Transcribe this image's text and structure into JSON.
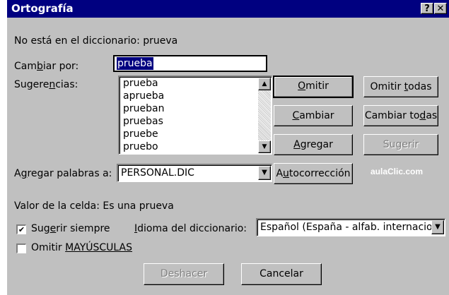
{
  "window": {
    "title": "Ortografía",
    "help_button": "?",
    "close_button": "✕"
  },
  "not_in_dictionary": "No está en el diccionario: prueva",
  "change_to": {
    "label_pre": "Cam",
    "label_u": "b",
    "label_post": "iar por:",
    "value": "prueba"
  },
  "suggestions": {
    "label_pre": "Sugere",
    "label_u": "n",
    "label_post": "cias:",
    "items": [
      "prueba",
      "aprueba",
      "prueban",
      "pruebas",
      "pruebe",
      "pruebo"
    ]
  },
  "buttons": {
    "omitir": {
      "pre": "",
      "u": "O",
      "post": "mitir"
    },
    "omitir_todas": {
      "pre": "Omitir ",
      "u": "t",
      "post": "odas"
    },
    "cambiar": {
      "pre": "",
      "u": "C",
      "post": "ambiar"
    },
    "cambiar_todas": {
      "pre": "Cambiar to",
      "u": "d",
      "post": "as"
    },
    "agregar": {
      "pre": "",
      "u": "A",
      "post": "gregar"
    },
    "sugerir": {
      "pre": "",
      "u": "",
      "post": "Sugerir"
    },
    "autocorreccion": {
      "pre": "A",
      "u": "u",
      "post": "tocorrección"
    },
    "deshacer": "Deshacer",
    "cancelar": "Cancelar"
  },
  "add_words": {
    "label_pre": "A",
    "label_u": "g",
    "label_post": "regar palabras a:",
    "value": "PERSONAL.DIC"
  },
  "watermark": "aulaClic.com",
  "cell_value": "Valor de la celda: Es una prueva",
  "suggest_always": {
    "pre": "Sug",
    "u": "e",
    "post": "rir siempre",
    "checked": true
  },
  "ignore_uppercase": {
    "pre": "Omitir ",
    "u": "MAYÚSCULAS",
    "post": "",
    "checked": false
  },
  "dictionary_language": {
    "label_pre": "",
    "label_u": "I",
    "label_post": "dioma del diccionario:",
    "value": "Español (España - alfab. internacio"
  },
  "icons": {
    "check": "✔",
    "up": "▲",
    "down": "▼"
  }
}
